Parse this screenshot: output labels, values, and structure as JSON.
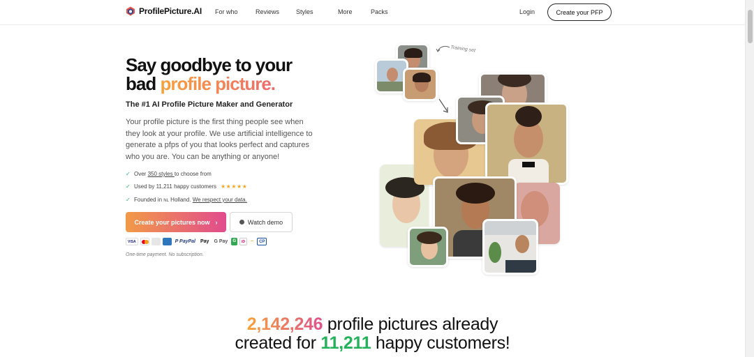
{
  "nav": {
    "logo_text": "ProfilePicture.AI",
    "links": [
      "For who",
      "Reviews",
      "Styles",
      "More",
      "Packs"
    ],
    "login": "Login",
    "cta": "Create your PFP"
  },
  "hero": {
    "headline_line1": "Say goodbye to your",
    "headline_line2_plain": "bad ",
    "headline_line2_accent": "profile picture.",
    "subhead": "The #1 AI Profile Picture Maker and Generator",
    "description": "Your profile picture is the first thing people see when they look at your profile. We use artificial intelligence to generate a pfps of you that looks perfect and captures who you are. You can be anything or anyone!",
    "checks": {
      "styles_prefix": "Over ",
      "styles_link": "350 styles ",
      "styles_suffix": "to choose from",
      "customers": "Used by 11,211 happy customers",
      "stars": "★★★★★",
      "founded_prefix": "Founded in ",
      "flag": "NL",
      "founded_place": " Holland. ",
      "data_link": "We respect your data."
    },
    "primary_button": "Create your pictures now",
    "primary_chevron": "›",
    "secondary_button": "Watch demo",
    "payments": [
      "VISA",
      "MC",
      "AMEX",
      "AX",
      "P PayPal",
      "Pay",
      "G Pay",
      "G",
      "iD",
      "~",
      "CP"
    ],
    "fineprint": "One-time payment. No subscription.",
    "training_label": "Training set"
  },
  "stats": {
    "count": "2,142,246",
    "line1_suffix": " profile pictures already",
    "line2_prefix": "created for ",
    "customers": "11,211",
    "line2_suffix": " happy customers!"
  },
  "colors": {
    "accent_orange": "#f7a23b",
    "accent_pink": "#e14b8d",
    "check_green": "#2bb673",
    "customers_green": "#22b35a"
  }
}
